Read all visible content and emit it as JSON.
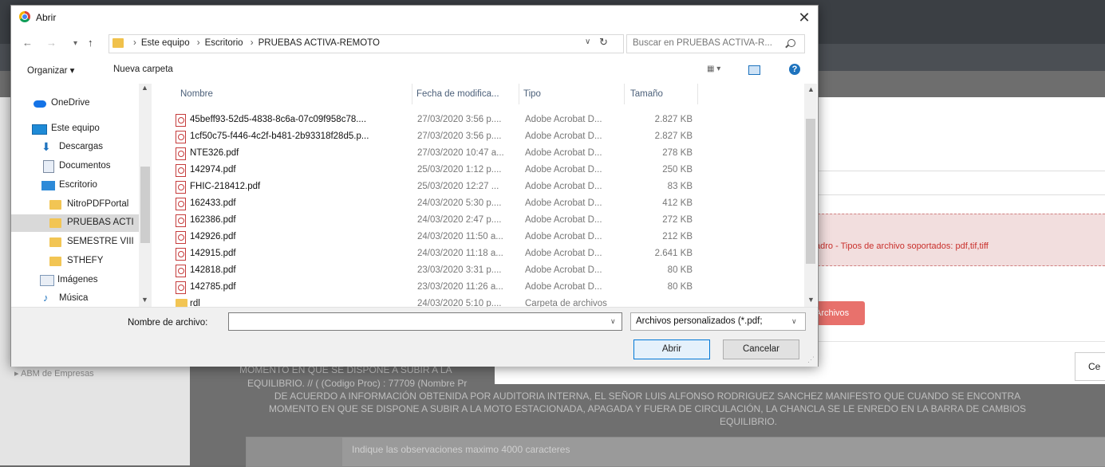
{
  "background_app": {
    "sidebar_item": "ABM de Empresas",
    "alert_text": "adro - Tipos de archivo soportados: pdf,tif,tiff",
    "red_button": "Archivos",
    "cancel_partial": "Ce",
    "text_lines": [
      "MOMENTO EN QUE SE DISPONE A SUBIR A LA",
      "EQUILIBRIO. // ( (Codigo Proc) : 77709 (Nombre Pr",
      "DE ACUERDO A INFORMACIÓN OBTENIDA POR AUDITORIA INTERNA, EL SEÑOR LUIS ALFONSO RODRIGUEZ SANCHEZ MANIFESTO QUE CUANDO SE ENCONTRA",
      "MOMENTO EN QUE SE DISPONE A SUBIR A LA MOTO ESTACIONADA, APAGADA Y FUERA DE CIRCULACIÓN, LA CHANCLA SE LE ENREDO EN LA BARRA DE CAMBIOS",
      "EQUILIBRIO."
    ],
    "observations_placeholder": "Indique las observaciones maximo 4000 caracteres"
  },
  "dialog": {
    "title": "Abrir",
    "close": "✕",
    "nav": {
      "back": "←",
      "forward": "→",
      "recent": "▾",
      "up": "↑"
    },
    "breadcrumb": [
      "Este equipo",
      "Escritorio",
      "PRUEBAS ACTIVA-REMOTO"
    ],
    "breadcrumb_sep": "›",
    "search_placeholder": "Buscar en PRUEBAS ACTIVA-R...",
    "toolbar": {
      "organize": "Organizar ▾",
      "new_folder": "Nueva carpeta",
      "view": "▦ ▾",
      "help": "?"
    },
    "nav_pane": [
      {
        "label": "OneDrive",
        "icon": "cloud-icon"
      },
      {
        "label": "Este equipo",
        "icon": "computer-icon"
      },
      {
        "label": "Descargas",
        "icon": "download-icon"
      },
      {
        "label": "Documentos",
        "icon": "document-icon"
      },
      {
        "label": "Escritorio",
        "icon": "desktop-icon"
      },
      {
        "label": "NitroPDFPortal",
        "icon": "folder-icon"
      },
      {
        "label": "PRUEBAS ACTI",
        "icon": "folder-icon"
      },
      {
        "label": "SEMESTRE VIII",
        "icon": "folder-icon"
      },
      {
        "label": "STHEFY",
        "icon": "folder-icon"
      },
      {
        "label": "Imágenes",
        "icon": "images-icon"
      },
      {
        "label": "Música",
        "icon": "music-icon"
      }
    ],
    "columns": {
      "name": "Nombre",
      "date": "Fecha de modifica...",
      "type": "Tipo",
      "size": "Tamaño"
    },
    "files": [
      {
        "name": "45beff93-52d5-4838-8c6a-07c09f958c78....",
        "date": "27/03/2020 3:56 p....",
        "type": "Adobe Acrobat D...",
        "size": "2.827 KB",
        "icon": "pdf-icon"
      },
      {
        "name": "1cf50c75-f446-4c2f-b481-2b93318f28d5.p...",
        "date": "27/03/2020 3:56 p....",
        "type": "Adobe Acrobat D...",
        "size": "2.827 KB",
        "icon": "pdf-icon"
      },
      {
        "name": "NTE326.pdf",
        "date": "27/03/2020 10:47 a...",
        "type": "Adobe Acrobat D...",
        "size": "278 KB",
        "icon": "pdf-icon"
      },
      {
        "name": "142974.pdf",
        "date": "25/03/2020 1:12 p....",
        "type": "Adobe Acrobat D...",
        "size": "250 KB",
        "icon": "pdf-icon"
      },
      {
        "name": "FHIC-218412.pdf",
        "date": "25/03/2020 12:27 ...",
        "type": "Adobe Acrobat D...",
        "size": "83 KB",
        "icon": "pdf-icon"
      },
      {
        "name": "162433.pdf",
        "date": "24/03/2020 5:30 p....",
        "type": "Adobe Acrobat D...",
        "size": "412 KB",
        "icon": "pdf-icon"
      },
      {
        "name": "162386.pdf",
        "date": "24/03/2020 2:47 p....",
        "type": "Adobe Acrobat D...",
        "size": "272 KB",
        "icon": "pdf-icon"
      },
      {
        "name": "142926.pdf",
        "date": "24/03/2020 11:50 a...",
        "type": "Adobe Acrobat D...",
        "size": "212 KB",
        "icon": "pdf-icon"
      },
      {
        "name": "142915.pdf",
        "date": "24/03/2020 11:18 a...",
        "type": "Adobe Acrobat D...",
        "size": "2.641 KB",
        "icon": "pdf-icon"
      },
      {
        "name": "142818.pdf",
        "date": "23/03/2020 3:31 p....",
        "type": "Adobe Acrobat D...",
        "size": "80 KB",
        "icon": "pdf-icon"
      },
      {
        "name": "142785.pdf",
        "date": "23/03/2020 11:26 a...",
        "type": "Adobe Acrobat D...",
        "size": "80 KB",
        "icon": "pdf-icon"
      },
      {
        "name": "rdl",
        "date": "24/03/2020 5:10 p....",
        "type": "Carpeta de archivos",
        "size": "",
        "icon": "folder-icon"
      }
    ],
    "filename_label": "Nombre de archivo:",
    "filename_value": "",
    "filetype_selected": "Archivos personalizados (*.pdf;",
    "open_button": "Abrir",
    "cancel_button": "Cancelar"
  }
}
